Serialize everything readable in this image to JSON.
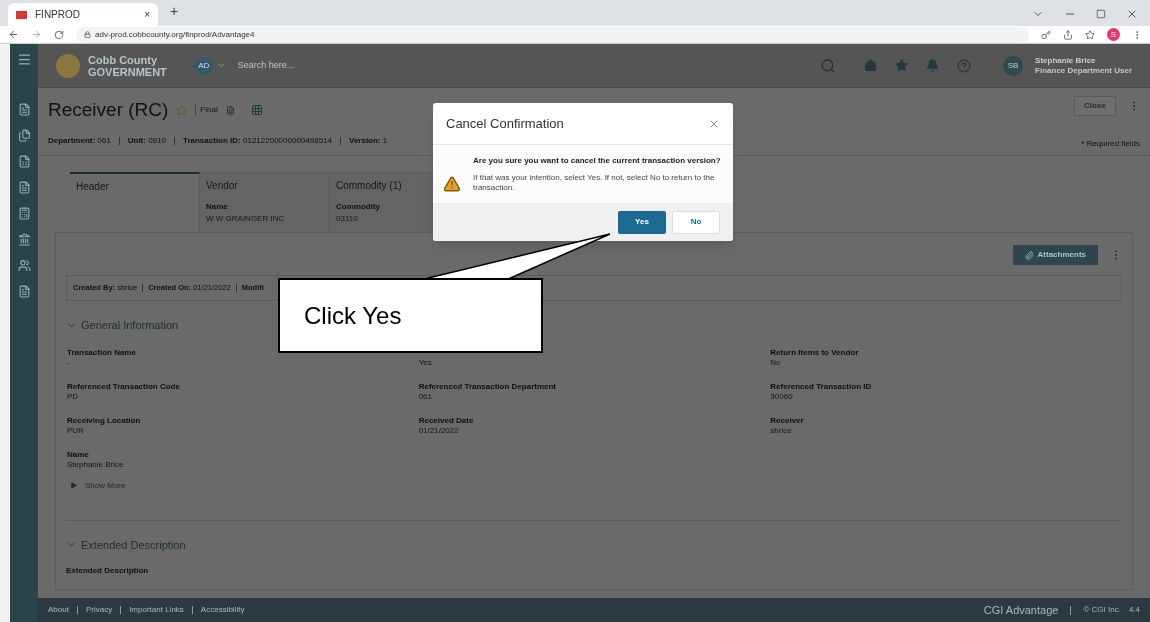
{
  "browser": {
    "tab_title": "FINPROD",
    "tab_close": "×",
    "new_tab": "+",
    "url": "adv-prod.cobbcounty.org/finprod/Advantage4",
    "profile_initial": "S"
  },
  "header": {
    "logo_line1": "Cobb County",
    "logo_line2": "GOVERNMENT",
    "scope_badge": "AD",
    "search": {
      "placeholder": "Search here..."
    },
    "user_initials": "SB",
    "user_name": "Stephanie Brice",
    "user_role": "Finance Department User"
  },
  "page": {
    "title": "Receiver (RC)",
    "status": "Final",
    "close_button": "Close",
    "required_note": "* Required fields",
    "meta": [
      {
        "label": "Department:",
        "value": "061"
      },
      {
        "label": "Unit:",
        "value": "0910"
      },
      {
        "label": "Transaction ID:",
        "value": "01212200000000498514"
      },
      {
        "label": "Version:",
        "value": "1"
      }
    ]
  },
  "tabs": [
    {
      "label": "Header",
      "selected": true
    },
    {
      "label": "Vendor",
      "selected": false,
      "field_label": "Name",
      "field_value": "W W GRAINGER INC"
    },
    {
      "label": "Commodity (1)",
      "selected": false,
      "field_label": "Commodity",
      "field_value": "03110"
    }
  ],
  "attachments_button": "Attachments",
  "audit": [
    {
      "label": "Created By:",
      "value": "sbrice"
    },
    {
      "label": "Created On:",
      "value": "01/21/2022"
    },
    {
      "label": "Modifi"
    }
  ],
  "general_section": {
    "title": "General Information",
    "expanded": true,
    "fields": [
      {
        "label": "Transaction Name",
        "value": "-"
      },
      {
        "value": "Yes"
      },
      {
        "label": "Return Items to Vendor",
        "value": "No"
      },
      {
        "label": "Referenced Transaction Code",
        "value": "PD"
      },
      {
        "label": "Referenced Transaction Department",
        "value": "061"
      },
      {
        "label": "Referenced Transaction ID",
        "value": "30060"
      },
      {
        "label": "Receiving Location",
        "value": "PUR"
      },
      {
        "label": "Received Date",
        "value": "01/21/2022"
      },
      {
        "label": "Receiver",
        "value": "sbrice"
      },
      {
        "label": "Name",
        "value": "Stephanie Brice"
      }
    ],
    "show_more": "Show More"
  },
  "extended_section": {
    "title": "Extended Description",
    "expanded": true,
    "field_label": "Extended Description"
  },
  "footer": {
    "links": [
      "About",
      "Privacy",
      "Important Links",
      "Accessibility"
    ],
    "brand": "CGI Advantage",
    "copyright": "© CGI Inc.",
    "version": "4.4"
  },
  "dialog": {
    "title": "Cancel Confirmation",
    "question": "Are you sure you want to cancel the current transaction version?",
    "message": "If that was your intention, select Yes. If not, select No to return to the transaction.",
    "buttons": [
      {
        "label": "Yes",
        "primary": true
      },
      {
        "label": "No",
        "primary": false
      }
    ]
  },
  "callout": {
    "text": "Click Yes"
  }
}
